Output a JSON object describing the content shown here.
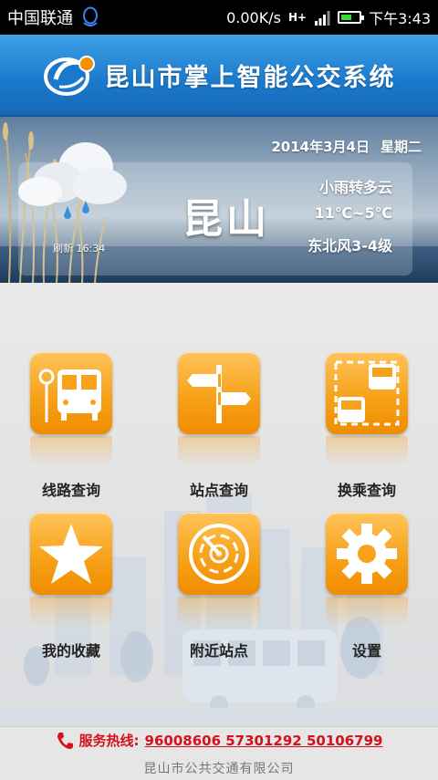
{
  "status_bar": {
    "carrier": "中国联通",
    "data_rate": "0.00K/s",
    "network": "H+",
    "time": "下午3:43",
    "battery_fill": 0.6
  },
  "header": {
    "title": "昆山市掌上智能公交系统"
  },
  "weather": {
    "date": "2014年3月4日",
    "weekday": "星期二",
    "city": "昆山",
    "condition": "小雨转多云",
    "temperature": "11℃~5℃",
    "wind": "东北风3-4级",
    "refresh_label": "刷新 16:34"
  },
  "menu": {
    "items": [
      {
        "label": "线路查询",
        "icon": "bus-stop-icon"
      },
      {
        "label": "站点查询",
        "icon": "signpost-icon"
      },
      {
        "label": "换乘查询",
        "icon": "transfer-icon"
      },
      {
        "label": "我的收藏",
        "icon": "star-icon"
      },
      {
        "label": "附近站点",
        "icon": "radar-icon"
      },
      {
        "label": "设置",
        "icon": "gear-icon"
      }
    ]
  },
  "footer": {
    "hotline_label": "服务热线:",
    "hotline_numbers": "96008606 57301292 50106799",
    "company": "昆山市公共交通有限公司"
  },
  "colors": {
    "header_blue": "#1a79cc",
    "tile_orange": "#f7a21a",
    "hotline_red": "#d4111e"
  }
}
